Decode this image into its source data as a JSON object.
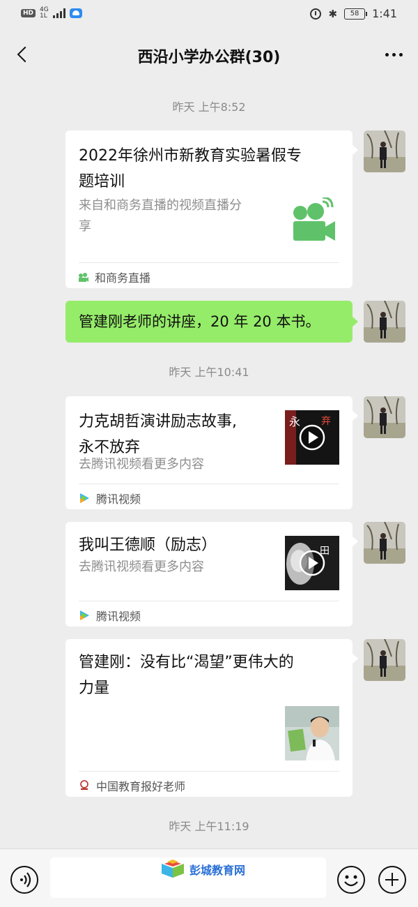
{
  "status_bar": {
    "hd": "HD",
    "network": "4G",
    "network_sub": "1L",
    "battery": "58",
    "time": "1:41",
    "bluetooth_glyph": "✱"
  },
  "header": {
    "back_icon": "chevron-left-icon",
    "title": "西沿小学办公群(30)",
    "more_icon": "more-dots-icon"
  },
  "timestamps": [
    "昨天  上午8:52",
    "昨天  上午10:41",
    "昨天  上午11:19"
  ],
  "messages": [
    {
      "type": "link-card",
      "title_lines": [
        "2022年徐州市新教育实验暑假专",
        "题培训"
      ],
      "desc_lines": [
        "来自和商务直播的视频直播分",
        "享"
      ],
      "source": "和商务直播",
      "thumb_icon": "video-camera-icon"
    },
    {
      "type": "text",
      "text": "管建刚老师的讲座，20 年 20 本书。",
      "bubble_color": "#95ec69"
    },
    {
      "type": "link-card",
      "title_lines": [
        "力克胡哲演讲励志故事,",
        "永不放弃"
      ],
      "desc_lines": [
        "去腾讯视频看更多内容"
      ],
      "source": "腾讯视频",
      "thumb_icon": "video-play-icon"
    },
    {
      "type": "link-card",
      "title_lines": [
        "我叫王德顺（励志）"
      ],
      "desc_lines": [
        "去腾讯视频看更多内容"
      ],
      "source": "腾讯视频",
      "thumb_icon": "video-play-icon"
    },
    {
      "type": "link-card",
      "title_lines": [
        "管建刚：没有比“渴望”更伟大的",
        "力量"
      ],
      "desc_lines": [],
      "source": "中国教育报好老师",
      "thumb_icon": "speaker-photo"
    }
  ],
  "input_bar": {
    "voice_icon": "voice-icon",
    "emoji_icon": "emoji-icon",
    "plus_icon": "plus-icon"
  },
  "watermark": "彭城教育网",
  "colors": {
    "background": "#ededed",
    "own_bubble": "#95ec69",
    "card": "#ffffff",
    "muted_text": "#8e8e8e"
  }
}
